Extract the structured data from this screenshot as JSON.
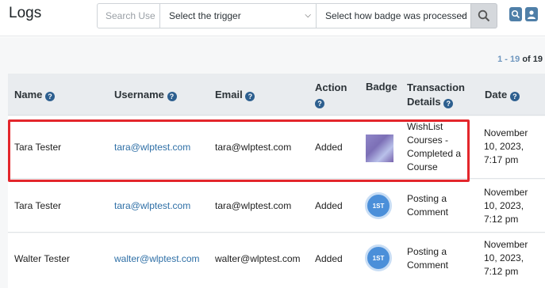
{
  "page": {
    "title": "Logs"
  },
  "filters": {
    "search_placeholder": "Search Use",
    "trigger_select": "Select the trigger",
    "badge_select": "Select how badge was processed"
  },
  "pager": {
    "range": "1 - 19",
    "of_label": "of 19"
  },
  "table": {
    "headers": {
      "name": "Name",
      "username": "Username",
      "email": "Email",
      "action": "Action",
      "badge": "Badge",
      "transaction_line1": "Transaction",
      "transaction_line2": "Details",
      "date": "Date"
    },
    "rows": [
      {
        "name": "Tara Tester",
        "username": "tara@wlptest.com",
        "email": "tara@wlptest.com",
        "action": "Added",
        "badge": "image",
        "details": [
          "WishList",
          "Courses -",
          "Completed a",
          "Course"
        ],
        "date": [
          "November",
          "10, 2023,",
          "7:17 pm"
        ]
      },
      {
        "name": "Tara Tester",
        "username": "tara@wlptest.com",
        "email": "tara@wlptest.com",
        "action": "Added",
        "badge": "1ST",
        "details": [
          "Posting a",
          "Comment"
        ],
        "date": [
          "November",
          "10, 2023,",
          "7:12 pm"
        ]
      },
      {
        "name": "Walter Tester",
        "username": "walter@wlptest.com",
        "email": "walter@wlptest.com",
        "action": "Added",
        "badge": "1ST",
        "details": [
          "Posting a",
          "Comment"
        ],
        "date": [
          "November",
          "10, 2023,",
          "7:12 pm"
        ]
      }
    ]
  },
  "icons": {
    "help": "?",
    "search": "search-icon",
    "chevron": "chevron-down-icon"
  },
  "colors": {
    "link": "#2e6fa6",
    "highlight": "#e3262c",
    "help_badge": "#2d5f8f"
  }
}
